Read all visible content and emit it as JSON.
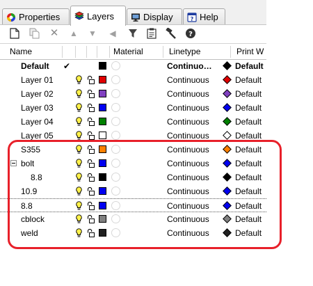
{
  "tabs": [
    {
      "label": "Properties",
      "icon": "color-wheel-icon",
      "active": false
    },
    {
      "label": "Layers",
      "icon": "layers-icon",
      "active": true
    },
    {
      "label": "Display",
      "icon": "monitor-icon",
      "active": false
    },
    {
      "label": "Help",
      "icon": "help-icon",
      "active": false
    }
  ],
  "toolbar": [
    "new-layer-icon",
    "new-sublayer-icon",
    "delete-icon",
    "move-up-icon",
    "move-down-icon",
    "move-out-icon",
    "filter-icon",
    "clipboard-icon",
    "tools-icon",
    "help-icon"
  ],
  "columns": {
    "name": "Name",
    "material": "Material",
    "linetype": "Linetype",
    "print_width": "Print W"
  },
  "layers": [
    {
      "name": "Default",
      "check": "✔",
      "bold": true,
      "color": "#000000",
      "linetype": "Continuo…",
      "print_color": "#000000",
      "print_width": "Default"
    },
    {
      "name": "Layer 01",
      "color": "#e00000",
      "linetype": "Continuous",
      "print_color": "#e00000",
      "print_width": "Default"
    },
    {
      "name": "Layer 02",
      "color": "#8040c0",
      "linetype": "Continuous",
      "print_color": "#8040c0",
      "print_width": "Default"
    },
    {
      "name": "Layer 03",
      "color": "#0000f0",
      "linetype": "Continuous",
      "print_color": "#0000f0",
      "print_width": "Default"
    },
    {
      "name": "Layer 04",
      "color": "#008000",
      "linetype": "Continuous",
      "print_color": "#008000",
      "print_width": "Default"
    },
    {
      "name": "Layer 05",
      "color": "#ffffff",
      "linetype": "Continuous",
      "print_color": "#ffffff",
      "print_width": "Default"
    },
    {
      "name": "S355",
      "color": "#ff8000",
      "linetype": "Continuous",
      "print_color": "#ff8000",
      "print_width": "Default"
    },
    {
      "name": "bolt",
      "expanded": true,
      "color": "#0000f0",
      "linetype": "Continuous",
      "print_color": "#0000f0",
      "print_width": "Default"
    },
    {
      "name": "8.8",
      "indent": true,
      "color": "#000000",
      "linetype": "Continuous",
      "print_color": "#000000",
      "print_width": "Default"
    },
    {
      "name": "10.9",
      "color": "#0000f0",
      "linetype": "Continuous",
      "print_color": "#0000f0",
      "print_width": "Default"
    },
    {
      "name": "8.8",
      "dotted": true,
      "color": "#0000f0",
      "linetype": "Continuous",
      "print_color": "#0000f0",
      "print_width": "Default"
    },
    {
      "name": "cblock",
      "color": "#808080",
      "linetype": "Continuous",
      "print_color": "#808080",
      "print_width": "Default"
    },
    {
      "name": "weld",
      "color": "#202020",
      "linetype": "Continuous",
      "print_color": "#202020",
      "print_width": "Default"
    }
  ]
}
